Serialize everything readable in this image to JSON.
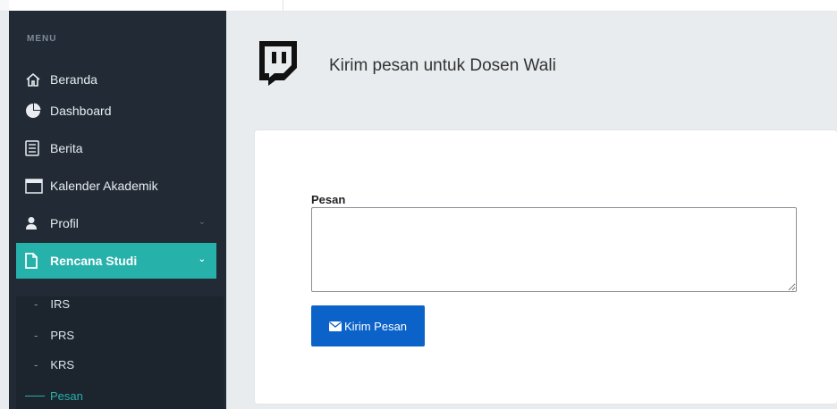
{
  "sidebar": {
    "menu_heading": "MENU",
    "items": [
      {
        "label": "Beranda",
        "icon": "home-icon"
      },
      {
        "label": "Dashboard",
        "icon": "pie-chart-icon"
      },
      {
        "label": "Berita",
        "icon": "newspaper-icon"
      },
      {
        "label": "Kalender Akademik",
        "icon": "calendar-icon"
      },
      {
        "label": "Profil",
        "icon": "user-icon"
      },
      {
        "label": "Rencana Studi",
        "icon": "file-icon"
      }
    ],
    "submenu": [
      {
        "label": "IRS"
      },
      {
        "label": "PRS"
      },
      {
        "label": "KRS"
      },
      {
        "label": "Pesan"
      }
    ],
    "active_color": "#27b1ab",
    "bg_color": "#212a35"
  },
  "header": {
    "title": "Kirim pesan untuk Dosen Wali",
    "icon": "twitch-icon"
  },
  "form": {
    "message_label": "Pesan",
    "message_value": "",
    "submit_label": "Kirim Pesan",
    "submit_icon": "envelope-icon",
    "button_color": "#0b63c9"
  }
}
